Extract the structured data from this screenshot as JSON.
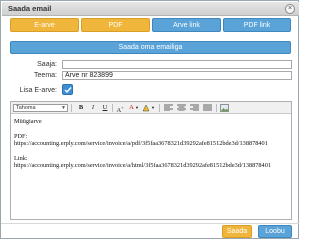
{
  "dialog": {
    "title": "Saada email",
    "close_glyph": "×"
  },
  "format_buttons": [
    {
      "label": "E-arve",
      "color": "#f0b63b"
    },
    {
      "label": "PDF",
      "color": "#f0b63b"
    },
    {
      "label": "Arve link",
      "color": "#5aa3d8"
    },
    {
      "label": "PDF link",
      "color": "#5aa3d8"
    }
  ],
  "send_to_client_label": "Saada oma emailiga",
  "form": {
    "to_label": "Saaja:",
    "to_value": "",
    "subject_label": "Teema:",
    "subject_value": "Arve nr 823899",
    "attach_label": "Lisa E-arve:",
    "attach_checked": true
  },
  "editor": {
    "font_select": "Tahoma",
    "toolbar_icons": [
      "bold-icon",
      "italic-icon",
      "underline-icon",
      "font-size-icon",
      "font-color-icon",
      "highlight-icon",
      "align-left-icon",
      "align-center-icon",
      "align-right-icon",
      "justify-icon",
      "image-icon"
    ],
    "content": [
      "Müügiarve",
      "",
      "PDF:",
      "https://accounting.erply.com/service/invoice/a/pdf/3f5faa3678321d39292afe81512bde3d/138878401",
      "",
      "Link:",
      "https://accounting.erply.com/service/invoice/a/html/3f5faa3678321d39292afe81512bde3d/138878401"
    ]
  },
  "actions": {
    "send_label": "Saada",
    "close_label": "Loobu"
  },
  "colors": {
    "accent_yellow": "#f0b63b",
    "accent_blue": "#5aa3d8",
    "checkbox_blue": "#3c8fd4"
  }
}
